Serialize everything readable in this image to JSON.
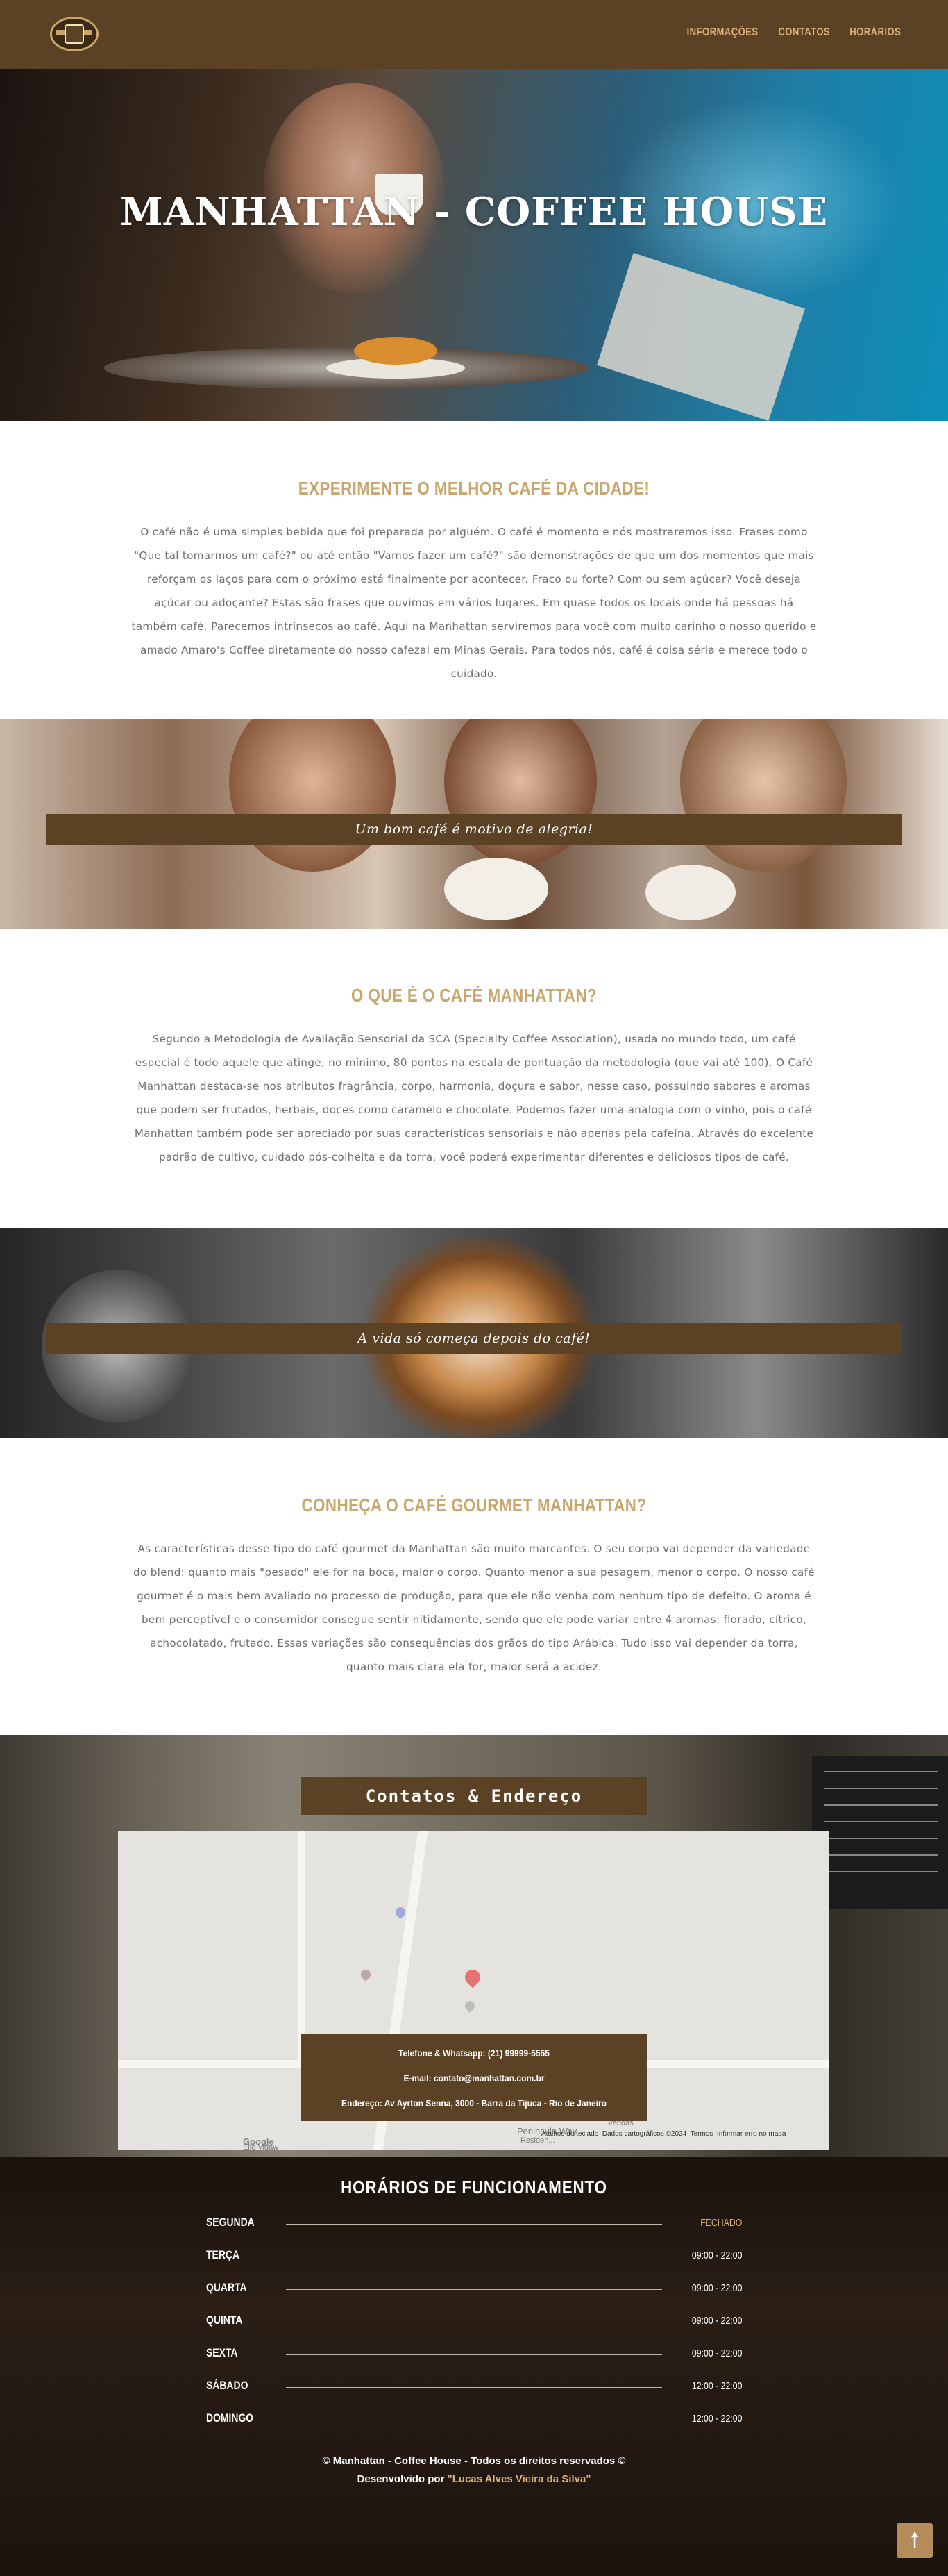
{
  "header": {
    "logo_name": "coffee-logo",
    "nav": [
      "INFORMAÇÕES",
      "CONTATOS",
      "HORÁRIOS"
    ]
  },
  "hero": {
    "title": "MANHATTAN - COFFEE HOUSE"
  },
  "section1": {
    "heading": "EXPERIMENTE O MELHOR CAFÉ DA CIDADE!",
    "body": "O café não é uma simples bebida que foi preparada por alguém. O café é momento e nós mostraremos isso. Frases como \"Que tal tomarmos um café?\" ou até então \"Vamos fazer um café?\" são demonstrações de que um dos momentos que mais reforçam os laços para com o próximo está finalmente por acontecer. Fraco ou forte? Com ou sem açúcar? Você deseja açúcar ou adoçante? Estas são frases que ouvimos em vários lugares. Em quase todos os locais onde há pessoas há também café. Parecemos intrínsecos ao café. Aqui na Manhattan serviremos para você com muito carinho o nosso querido e amado Amaro's Coffee diretamente do nosso cafezal em Minas Gerais. Para todos nós, café é coisa séria e merece todo o cuidado."
  },
  "band1": {
    "caption": "Um bom café é motivo de alegria!"
  },
  "section2": {
    "heading": "O QUE É O CAFÉ MANHATTAN?",
    "body": "Segundo a Metodologia de Avaliação Sensorial da SCA (Specialty Coffee Association), usada no mundo todo, um café especial é todo aquele que atinge, no mínimo, 80 pontos na escala de pontuação da metodologia (que vai até 100). O Café Manhattan destaca-se nos atributos fragrância, corpo, harmonia, doçura e sabor, nesse caso, possuindo sabores e aromas que podem ser frutados, herbais, doces como caramelo e chocolate. Podemos fazer uma analogia com o vinho, pois o café Manhattan também pode ser apreciado por suas características sensoriais e não apenas pela cafeína. Através do excelente padrão de cultivo, cuidado pós-colheita e da torra, você poderá experimentar diferentes e deliciosos tipos de café."
  },
  "band2": {
    "caption": "A vida só começa depois do café!"
  },
  "section3": {
    "heading": "CONHEÇA O CAFÉ GOURMET MANHATTAN?",
    "body": "As características desse tipo do café gourmet da Manhattan são muito marcantes. O seu corpo vai depender da variedade do blend: quanto mais \"pesado\" ele for na boca, maior o corpo. Quanto menor a sua pesagem, menor o corpo. O nosso café gourmet é o mais bem avaliado no processo de produção, para que ele não venha com nenhum tipo de defeito. O aroma é bem perceptível e o consumidor consegue sentir nitidamente, sendo que ele pode variar entre 4 aromas: florado, cítrico, achocolatado, frutado. Essas variações são consequências dos grãos do tipo Arábica. Tudo isso vai depender da torra, quanto mais clara ela for, maior será a acidez."
  },
  "contacts": {
    "title": "Contatos & Endereço",
    "map": {
      "google_label": "Google",
      "shortcuts": "Atalhos do teclado",
      "map_data": "Dados cartográficos ©2024",
      "terms": "Termos",
      "report": "Informar erro no mapa",
      "street1": "Peninsula Way",
      "street2": "Vendas",
      "street3": "Elio Vidaw",
      "residencial": "Residen..."
    },
    "phone": "Telefone & Whatsapp: (21) 99999-5555",
    "email": "E-mail: contato@manhattan.com.br",
    "address": "Endereço: Av Ayrton Senna, 3000 - Barra da Tijuca - Rio de Janeiro"
  },
  "hours": {
    "title": "HORÁRIOS DE FUNCIONAMENTO",
    "rows": [
      {
        "day": "SEGUNDA",
        "time": "FECHADO"
      },
      {
        "day": "TERÇA",
        "time": "09:00 - 22:00"
      },
      {
        "day": "QUARTA",
        "time": "09:00 - 22:00"
      },
      {
        "day": "QUINTA",
        "time": "09:00 - 22:00"
      },
      {
        "day": "SEXTA",
        "time": "09:00 - 22:00"
      },
      {
        "day": "SÁBADO",
        "time": "12:00 - 22:00"
      },
      {
        "day": "DOMINGO",
        "time": "12:00 - 22:00"
      }
    ]
  },
  "footer": {
    "copyright": "© Manhattan - Coffee House - Todos os direitos reservados ©",
    "credit_prefix": "Desenvolvido por",
    "credit_name": "\"Lucas Alves Vieira da Silva\""
  },
  "colors": {
    "brand_brown": "#5c4224",
    "accent_gold": "#c9a66b",
    "text_gray": "#6e6e6e"
  },
  "icons": {
    "to_top": "arrow-up-icon"
  }
}
